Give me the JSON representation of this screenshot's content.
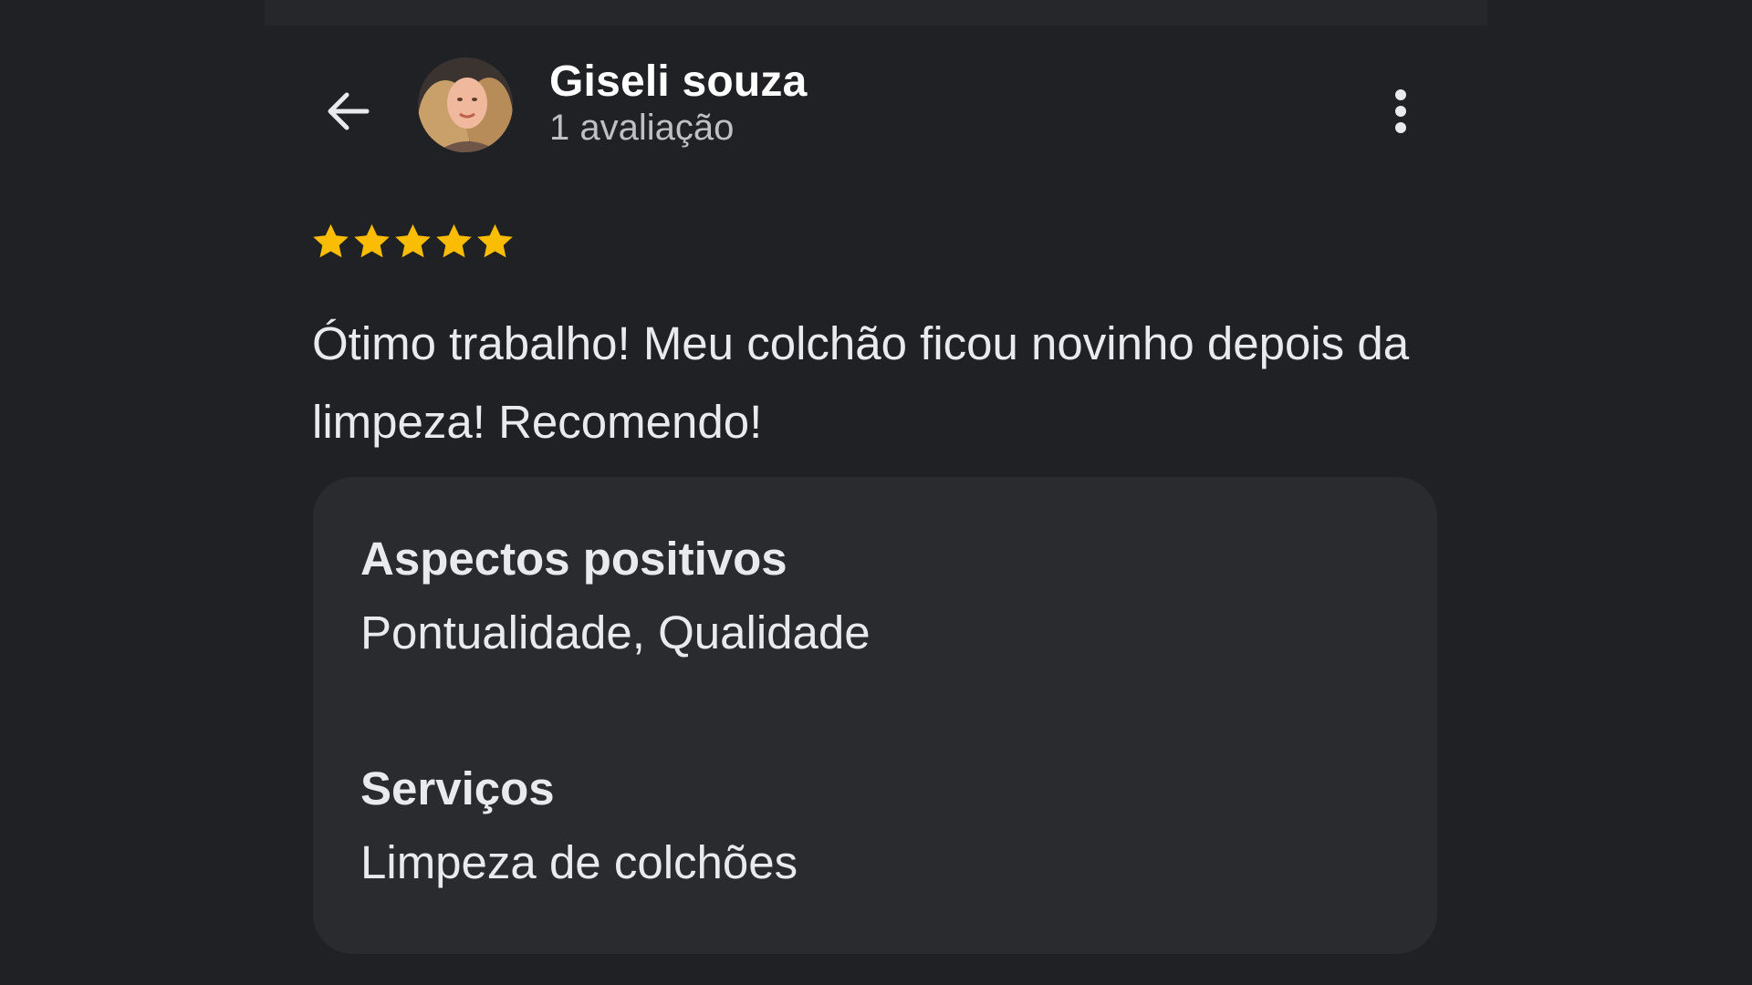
{
  "header": {
    "back_icon": "arrow-left-icon",
    "avatar_icon": "user-photo",
    "user_name": "Giseli souza",
    "review_count": "1 avaliação",
    "more_icon": "more-vertical-icon"
  },
  "review": {
    "rating": 5,
    "rating_max": 5,
    "star_color": "#fbbc04",
    "text": "Ótimo trabalho! Meu colchão ficou novinho depois da limpeza! Recomendo!"
  },
  "details": {
    "positive_heading": "Aspectos positivos",
    "positive_value": "Pontualidade, Qualidade",
    "services_heading": "Serviços",
    "services_value": "Limpeza de colchões"
  }
}
